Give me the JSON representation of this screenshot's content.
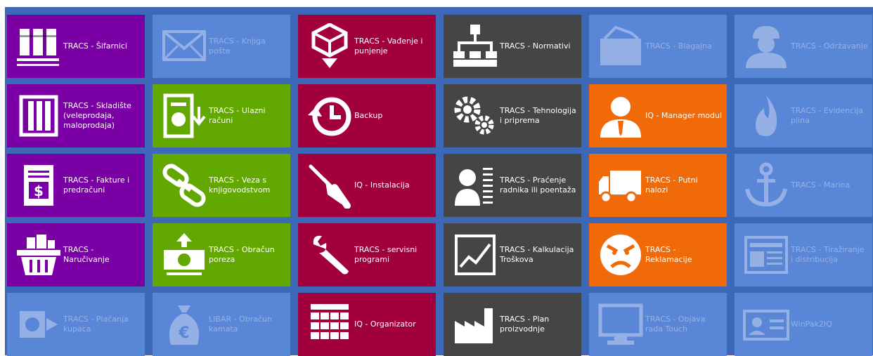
{
  "colors": {
    "background": "#3d67b7",
    "purple": "#7a00a5",
    "green": "#62a800",
    "crimson": "#a2003d",
    "charcoal": "#454545",
    "orange": "#f06a0a",
    "disabled": "#5a86d8"
  },
  "tiles": [
    {
      "label": "TRACS - Šifarnici",
      "icon": "books-icon",
      "color": "purple",
      "enabled": true
    },
    {
      "label": "TRACS - Skladište (veleprodaja, maloprodaja)",
      "icon": "warehouse-crate-icon",
      "color": "purple",
      "enabled": true
    },
    {
      "label": "TRACS - Fakture i predračuni",
      "icon": "invoice-icon",
      "color": "purple",
      "enabled": true
    },
    {
      "label": "TRACS - Naručivanje",
      "icon": "basket-icon",
      "color": "purple",
      "enabled": true
    },
    {
      "label": "TRACS - Plaćanja kupaca",
      "icon": "payment-icon",
      "color": "disabled",
      "enabled": false
    },
    {
      "label": "TRACS - Knjiga pošte",
      "icon": "envelope-icon",
      "color": "disabled",
      "enabled": false
    },
    {
      "label": "TRACS - Ulazni računi",
      "icon": "incoming-invoice-icon",
      "color": "green",
      "enabled": true
    },
    {
      "label": "TRACS - Veza s knjigovodstvom",
      "icon": "chain-link-icon",
      "color": "green",
      "enabled": true
    },
    {
      "label": "TRACS - Obračun poreza",
      "icon": "money-upload-icon",
      "color": "green",
      "enabled": true
    },
    {
      "label": "LIBAR - Obračun kamata",
      "icon": "euro-bag-icon",
      "color": "disabled",
      "enabled": false
    },
    {
      "label": "TRACS - Vađenje i punjenje",
      "icon": "box-down-icon",
      "color": "crimson",
      "enabled": true
    },
    {
      "label": "Backup",
      "icon": "history-icon",
      "color": "crimson",
      "enabled": true
    },
    {
      "label": "IQ - Instalacija",
      "icon": "screwdriver-icon",
      "color": "crimson",
      "enabled": true
    },
    {
      "label": "TRACS - servisni programi",
      "icon": "wrench-icon",
      "color": "crimson",
      "enabled": true
    },
    {
      "label": "IQ - Organizator",
      "icon": "calendar-grid-icon",
      "color": "crimson",
      "enabled": true
    },
    {
      "label": "TRACS - Normativi",
      "icon": "hierarchy-icon",
      "color": "charcoal",
      "enabled": true
    },
    {
      "label": "TRACS - Tehnologija i priprema",
      "icon": "gears-icon",
      "color": "charcoal",
      "enabled": true
    },
    {
      "label": "TRACS - Praćenje radnika ili poentaža",
      "icon": "worker-list-icon",
      "color": "charcoal",
      "enabled": true
    },
    {
      "label": "TRACS - Kalkulacija Troškova",
      "icon": "line-chart-icon",
      "color": "charcoal",
      "enabled": true
    },
    {
      "label": "TRACS - Plan proizvodnje",
      "icon": "factory-icon",
      "color": "charcoal",
      "enabled": true
    },
    {
      "label": "TRACS - Blagajna",
      "icon": "cash-register-icon",
      "color": "disabled",
      "enabled": false
    },
    {
      "label": "IQ - Manager modul",
      "icon": "manager-icon",
      "color": "orange",
      "enabled": true
    },
    {
      "label": "TRACS - Putni nalozi",
      "icon": "truck-icon",
      "color": "orange",
      "enabled": true
    },
    {
      "label": "TRACS - Reklamacije",
      "icon": "angry-face-icon",
      "color": "orange",
      "enabled": true
    },
    {
      "label": "TRACS - Objava rada Touch",
      "icon": "touch-screen-icon",
      "color": "disabled",
      "enabled": false
    },
    {
      "label": "TRACS - Održavanje",
      "icon": "maintenance-worker-icon",
      "color": "disabled",
      "enabled": false
    },
    {
      "label": "TRACS - Evidencija plina",
      "icon": "gas-flame-icon",
      "color": "disabled",
      "enabled": false
    },
    {
      "label": "TRACS - Marina",
      "icon": "anchor-icon",
      "color": "disabled",
      "enabled": false
    },
    {
      "label": "TRACS - Tiražiranje i distribucija",
      "icon": "newspaper-icon",
      "color": "disabled",
      "enabled": false
    },
    {
      "label": "WinPak2IQ",
      "icon": "id-card-icon",
      "color": "disabled",
      "enabled": false
    }
  ]
}
